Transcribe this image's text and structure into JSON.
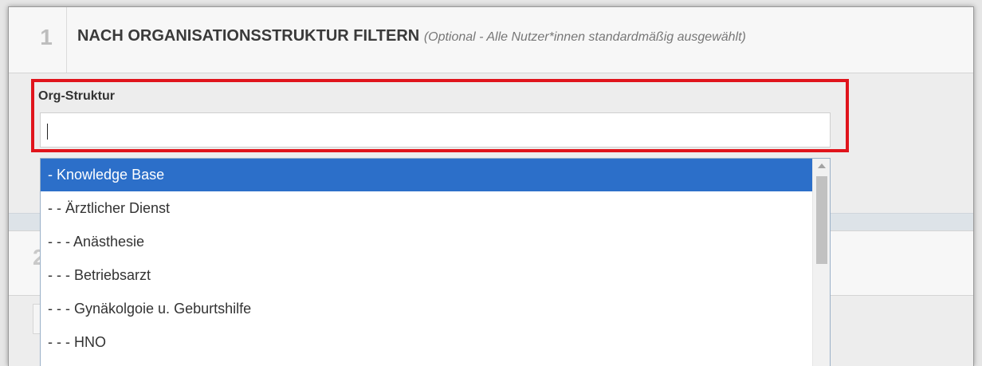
{
  "section1": {
    "number": "1",
    "title": "NACH ORGANISATIONSSTRUKTUR FILTERN",
    "subtitle": "(Optional - Alle Nutzer*innen standardmäßig ausgewählt)"
  },
  "org_field": {
    "label": "Org-Struktur",
    "value": ""
  },
  "dropdown": {
    "items": [
      {
        "label": "- Knowledge Base",
        "selected": true
      },
      {
        "label": "- - Ärztlicher Dienst",
        "selected": false
      },
      {
        "label": "- - - Anästhesie",
        "selected": false
      },
      {
        "label": "- - - Betriebsarzt",
        "selected": false
      },
      {
        "label": "- - - Gynäkolgoie u. Geburtshilfe",
        "selected": false
      },
      {
        "label": "- - - HNO",
        "selected": false
      }
    ]
  },
  "section2": {
    "number": "2"
  },
  "colors": {
    "highlight": "#e0141c",
    "selected_item": "#2c6fc9"
  }
}
